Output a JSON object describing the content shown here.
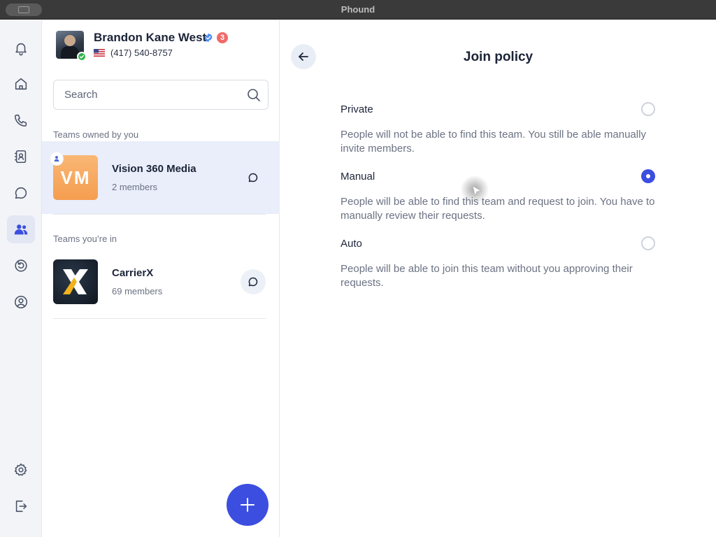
{
  "window": {
    "title": "Phound"
  },
  "rail": {
    "icons": [
      "bell-icon",
      "home-icon",
      "phone-icon",
      "contacts-icon",
      "chat-icon",
      "teams-icon",
      "sync-icon",
      "profile-icon",
      "settings-icon",
      "logout-icon"
    ],
    "active": "teams-icon",
    "active_color": "#3b4ee0"
  },
  "profile": {
    "name": "Brandon Kane West",
    "notification_count": "3",
    "phone": "(417) 540-8757",
    "status": "online"
  },
  "search": {
    "placeholder": "Search"
  },
  "teams_owned": {
    "label": "Teams owned by you",
    "items": [
      {
        "initials": "VM",
        "name": "Vision 360 Media",
        "members": "2 members"
      }
    ]
  },
  "teams_in": {
    "label": "Teams you’re in",
    "items": [
      {
        "name": "CarrierX",
        "members": "69 members"
      }
    ]
  },
  "join_policy": {
    "title": "Join policy",
    "selected": "Manual",
    "options": [
      {
        "label": "Private",
        "description": "People will not be able to find this team. You still be able manually invite members.",
        "checked": false
      },
      {
        "label": "Manual",
        "description": "People will be able to find this team and request to join. You have to manually review their requests.",
        "checked": true
      },
      {
        "label": "Auto",
        "description": "People will be able to join this team without you approving their requests.",
        "checked": false
      }
    ]
  },
  "colors": {
    "accent": "#3b4ee0",
    "badge": "#f06a6a",
    "online": "#2fb34a",
    "selected_row": "#eaeefa"
  }
}
